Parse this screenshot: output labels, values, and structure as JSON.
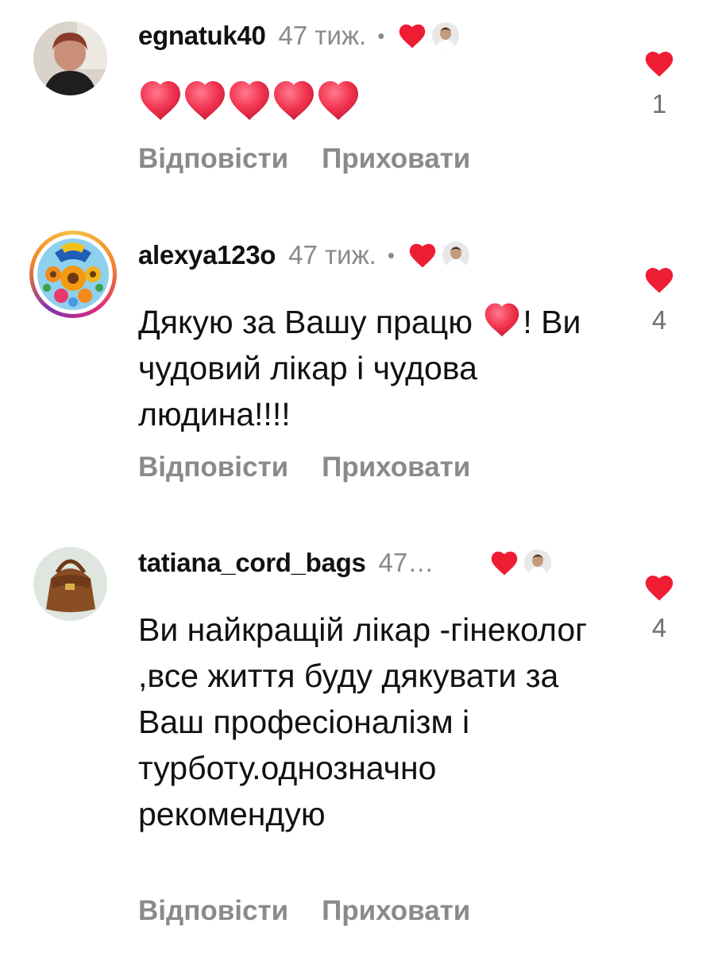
{
  "colors": {
    "heart": "#ee1d34",
    "muted": "#8a8a8a",
    "text": "#111111"
  },
  "comments": [
    {
      "username": "egnatuk40",
      "time": "47 тиж.",
      "separator": "•",
      "text": "",
      "emoji": "❤️❤️❤️❤️❤️",
      "likes": "1",
      "reply": "Відповісти",
      "hide": "Приховати",
      "liked_by_creator": true
    },
    {
      "username": "alexya123o",
      "time": "47 тиж.",
      "separator": "•",
      "text_part1": "Дякую за Вашу працю ",
      "text_part2": "! Ви чудовий лікар і чудова людина!!!!",
      "likes": "4",
      "reply": "Відповісти",
      "hide": "Приховати",
      "liked_by_creator": true
    },
    {
      "username": "tatiana_cord_bags",
      "time": "47…",
      "text": "Ви найкращій лікар -гінеколог ,все життя буду дякувати за Ваш професіоналізм і турботу.однозначно рекомендую",
      "likes": "4",
      "reply": "Відповісти",
      "hide": "Приховати",
      "liked_by_creator": true
    }
  ]
}
